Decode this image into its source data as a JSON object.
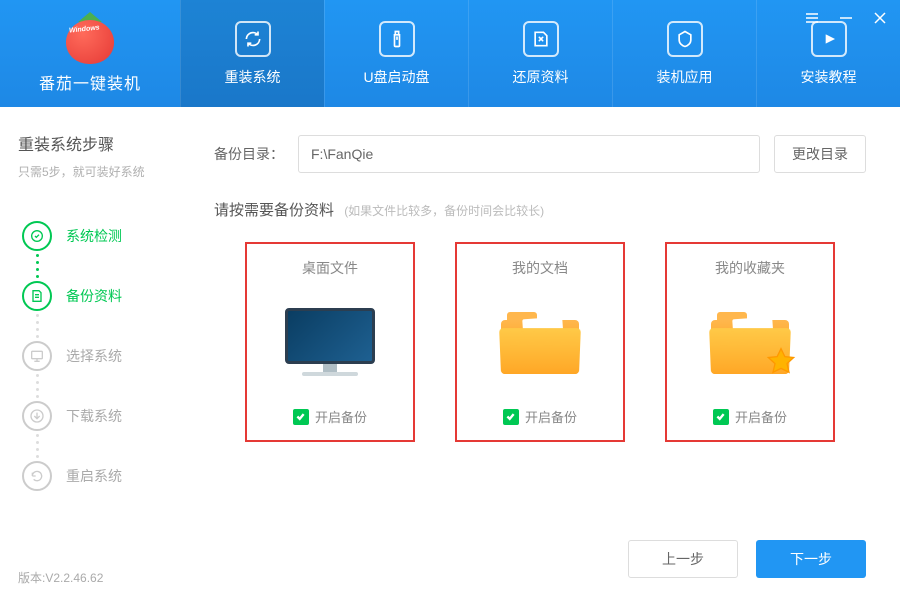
{
  "app": {
    "title": "番茄一键装机",
    "logo_text": "Windows"
  },
  "window_controls": {
    "menu": "menu",
    "min": "min",
    "close": "close"
  },
  "nav": [
    {
      "label": "重装系统",
      "icon": "reinstall",
      "active": true
    },
    {
      "label": "U盘启动盘",
      "icon": "usb"
    },
    {
      "label": "还原资料",
      "icon": "restore"
    },
    {
      "label": "装机应用",
      "icon": "apps"
    },
    {
      "label": "安装教程",
      "icon": "tutorial"
    }
  ],
  "sidebar": {
    "title": "重装系统步骤",
    "subtitle": "只需5步，就可装好系统",
    "steps": [
      {
        "label": "系统检测",
        "state": "done",
        "icon": "check"
      },
      {
        "label": "备份资料",
        "state": "active",
        "icon": "backup"
      },
      {
        "label": "选择系统",
        "state": "pending",
        "icon": "select"
      },
      {
        "label": "下载系统",
        "state": "pending",
        "icon": "download"
      },
      {
        "label": "重启系统",
        "state": "pending",
        "icon": "restart"
      }
    ],
    "version_label": "版本:V2.2.46.62"
  },
  "main": {
    "dir_label": "备份目录：",
    "dir_value": "F:\\FanQie",
    "dir_change": "更改目录",
    "prompt": "请按需要备份资料",
    "prompt_sub": "(如果文件比较多，备份时间会比较长)",
    "cards": [
      {
        "title": "桌面文件",
        "check_label": "开启备份",
        "visual": "monitor",
        "checked": true
      },
      {
        "title": "我的文档",
        "check_label": "开启备份",
        "visual": "folder",
        "checked": true
      },
      {
        "title": "我的收藏夹",
        "check_label": "开启备份",
        "visual": "folder-star",
        "checked": true
      }
    ],
    "prev": "上一步",
    "next": "下一步"
  }
}
